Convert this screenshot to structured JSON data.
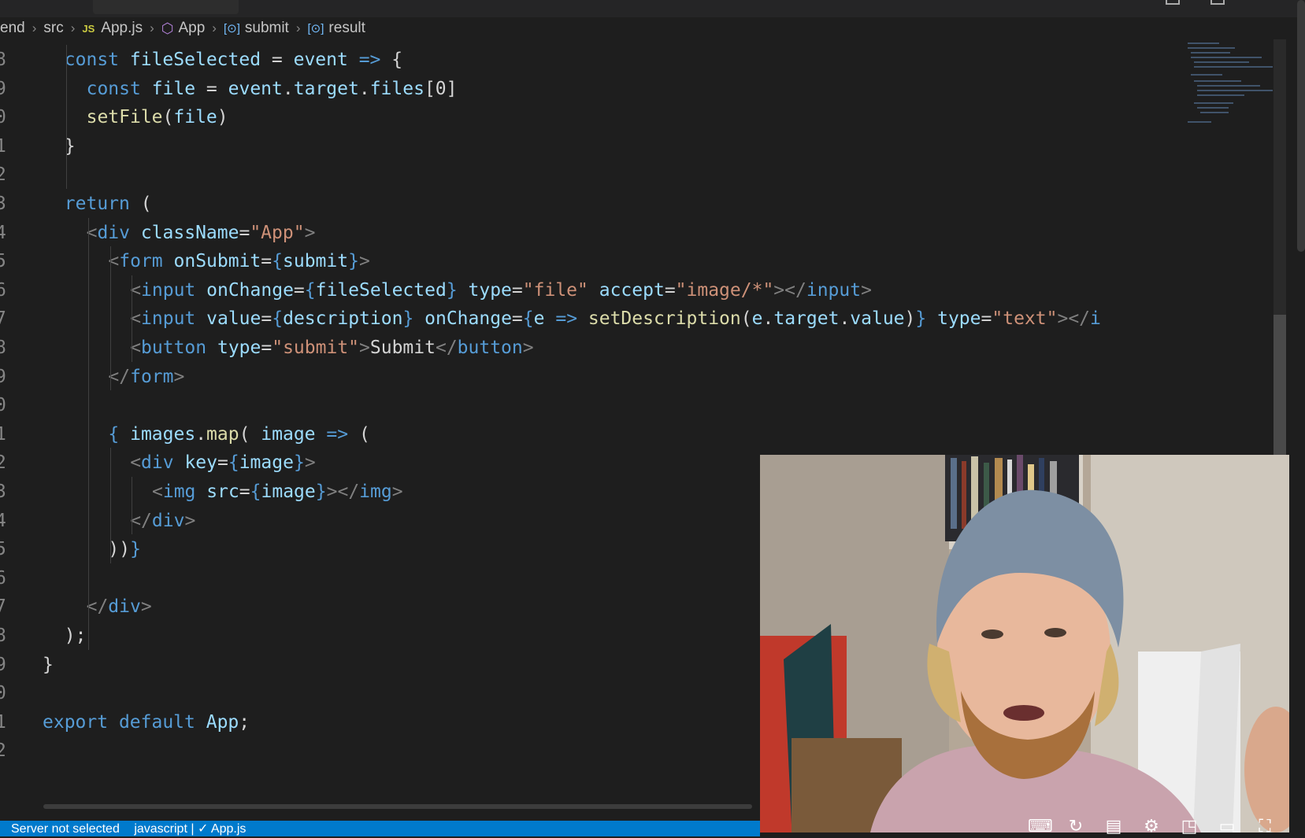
{
  "breadcrumb": {
    "items": [
      "end",
      "src",
      "App.js",
      "App",
      "submit",
      "result"
    ],
    "js_badge": "JS"
  },
  "code_lines": [
    {
      "num": "8",
      "parts": [
        [
          "kw",
          "const "
        ],
        [
          "vr",
          "fileSelected"
        ],
        [
          "tx",
          " = "
        ],
        [
          "vr",
          "event"
        ],
        [
          "kw",
          " => "
        ],
        [
          "tx",
          "{"
        ]
      ]
    },
    {
      "num": "9",
      "parts": [
        [
          "kw",
          "const "
        ],
        [
          "vr",
          "file"
        ],
        [
          "tx",
          " = "
        ],
        [
          "vr",
          "event"
        ],
        [
          "tx",
          "."
        ],
        [
          "vr",
          "target"
        ],
        [
          "tx",
          "."
        ],
        [
          "vr",
          "files"
        ],
        [
          "tx",
          "[0]"
        ]
      ]
    },
    {
      "num": "0",
      "parts": [
        [
          "fn",
          "setFile"
        ],
        [
          "tx",
          "("
        ],
        [
          "vr",
          "file"
        ],
        [
          "tx",
          ")"
        ]
      ]
    },
    {
      "num": "1",
      "parts": [
        [
          "tx",
          "}"
        ]
      ]
    },
    {
      "num": "2",
      "parts": []
    },
    {
      "num": "3",
      "parts": [
        [
          "kw",
          "return "
        ],
        [
          "tx",
          "("
        ]
      ]
    },
    {
      "num": "4",
      "parts": [
        [
          "pu",
          "<"
        ],
        [
          "tg",
          "div "
        ],
        [
          "at",
          "className"
        ],
        [
          "tx",
          "="
        ],
        [
          "st",
          "\"App\""
        ],
        [
          "pu",
          ">"
        ]
      ]
    },
    {
      "num": "5",
      "parts": [
        [
          "pu",
          "<"
        ],
        [
          "tg",
          "form "
        ],
        [
          "at",
          "onSubmit"
        ],
        [
          "tx",
          "="
        ],
        [
          "br",
          "{"
        ],
        [
          "vr",
          "submit"
        ],
        [
          "br",
          "}"
        ],
        [
          "pu",
          ">"
        ]
      ]
    },
    {
      "num": "6",
      "parts": [
        [
          "pu",
          "<"
        ],
        [
          "tg",
          "input "
        ],
        [
          "at",
          "onChange"
        ],
        [
          "tx",
          "="
        ],
        [
          "br",
          "{"
        ],
        [
          "vr",
          "fileSelected"
        ],
        [
          "br",
          "}"
        ],
        [
          "at",
          " type"
        ],
        [
          "tx",
          "="
        ],
        [
          "st",
          "\"file\""
        ],
        [
          "at",
          " accept"
        ],
        [
          "tx",
          "="
        ],
        [
          "st",
          "\"image/*\""
        ],
        [
          "pu",
          "></"
        ],
        [
          "tg",
          "input"
        ],
        [
          "pu",
          ">"
        ]
      ]
    },
    {
      "num": "7",
      "parts": [
        [
          "pu",
          "<"
        ],
        [
          "tg",
          "input "
        ],
        [
          "at",
          "value"
        ],
        [
          "tx",
          "="
        ],
        [
          "br",
          "{"
        ],
        [
          "vr",
          "description"
        ],
        [
          "br",
          "}"
        ],
        [
          "at",
          " onChange"
        ],
        [
          "tx",
          "="
        ],
        [
          "br",
          "{"
        ],
        [
          "vr",
          "e"
        ],
        [
          "kw",
          " => "
        ],
        [
          "fn",
          "setDescription"
        ],
        [
          "tx",
          "("
        ],
        [
          "vr",
          "e"
        ],
        [
          "tx",
          "."
        ],
        [
          "vr",
          "target"
        ],
        [
          "tx",
          "."
        ],
        [
          "vr",
          "value"
        ],
        [
          "tx",
          ")"
        ],
        [
          "br",
          "}"
        ],
        [
          "at",
          " type"
        ],
        [
          "tx",
          "="
        ],
        [
          "st",
          "\"text\""
        ],
        [
          "pu",
          "></"
        ],
        [
          "tg",
          "i"
        ]
      ]
    },
    {
      "num": "8",
      "parts": [
        [
          "pu",
          "<"
        ],
        [
          "tg",
          "button "
        ],
        [
          "at",
          "type"
        ],
        [
          "tx",
          "="
        ],
        [
          "st",
          "\"submit\""
        ],
        [
          "pu",
          ">"
        ],
        [
          "tx",
          "Submit"
        ],
        [
          "pu",
          "</"
        ],
        [
          "tg",
          "button"
        ],
        [
          "pu",
          ">"
        ]
      ]
    },
    {
      "num": "9",
      "parts": [
        [
          "pu",
          "</"
        ],
        [
          "tg",
          "form"
        ],
        [
          "pu",
          ">"
        ]
      ]
    },
    {
      "num": "0",
      "parts": []
    },
    {
      "num": "1",
      "parts": [
        [
          "br",
          "{ "
        ],
        [
          "vr",
          "images"
        ],
        [
          "tx",
          "."
        ],
        [
          "fn",
          "map"
        ],
        [
          "tx",
          "( "
        ],
        [
          "vr",
          "image"
        ],
        [
          "kw",
          " => "
        ],
        [
          "tx",
          "("
        ]
      ]
    },
    {
      "num": "2",
      "parts": [
        [
          "pu",
          "<"
        ],
        [
          "tg",
          "div "
        ],
        [
          "at",
          "key"
        ],
        [
          "tx",
          "="
        ],
        [
          "br",
          "{"
        ],
        [
          "vr",
          "image"
        ],
        [
          "br",
          "}"
        ],
        [
          "pu",
          ">"
        ]
      ]
    },
    {
      "num": "3",
      "parts": [
        [
          "pu",
          "<"
        ],
        [
          "tg",
          "img "
        ],
        [
          "at",
          "src"
        ],
        [
          "tx",
          "="
        ],
        [
          "br",
          "{"
        ],
        [
          "vr",
          "image"
        ],
        [
          "br",
          "}"
        ],
        [
          "pu",
          "></"
        ],
        [
          "tg",
          "img"
        ],
        [
          "pu",
          ">"
        ]
      ]
    },
    {
      "num": "4",
      "parts": [
        [
          "pu",
          "</"
        ],
        [
          "tg",
          "div"
        ],
        [
          "pu",
          ">"
        ]
      ]
    },
    {
      "num": "5",
      "parts": [
        [
          "tx",
          "))"
        ],
        [
          "br",
          "}"
        ]
      ]
    },
    {
      "num": "6",
      "parts": []
    },
    {
      "num": "7",
      "parts": [
        [
          "pu",
          "</"
        ],
        [
          "tg",
          "div"
        ],
        [
          "pu",
          ">"
        ]
      ]
    },
    {
      "num": "8",
      "parts": [
        [
          "tx",
          ");"
        ]
      ]
    },
    {
      "num": "9",
      "parts": [
        [
          "tx",
          "}"
        ]
      ]
    },
    {
      "num": "0",
      "parts": []
    },
    {
      "num": "1",
      "parts": [
        [
          "kw",
          "export "
        ],
        [
          "kw",
          "default "
        ],
        [
          "vr",
          "App"
        ],
        [
          "tx",
          ";"
        ]
      ]
    },
    {
      "num": "2",
      "parts": []
    }
  ],
  "statusbar": {
    "server": "Server not selected",
    "language": "javascript | ✓ App.js"
  },
  "video_controls": [
    "keyboard-icon",
    "autoplay-icon",
    "subtitles-icon",
    "settings-icon",
    "miniplayer-icon",
    "theater-icon",
    "fullscreen-icon"
  ]
}
